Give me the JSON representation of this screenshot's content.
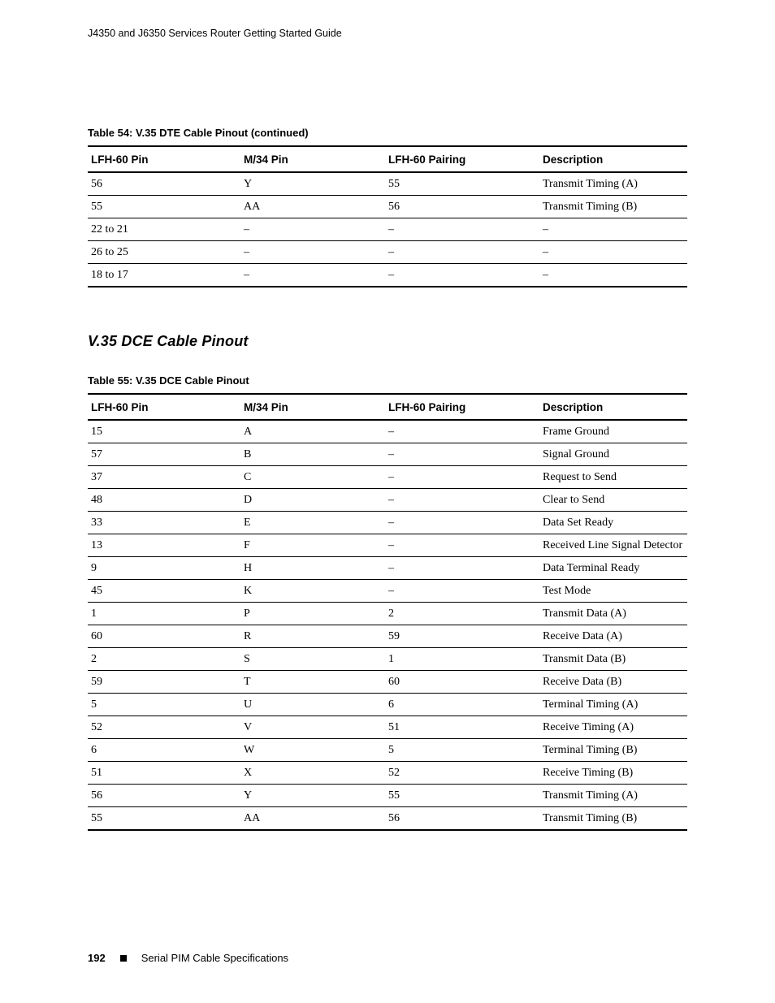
{
  "header": {
    "running_head": "J4350 and J6350 Services Router Getting Started Guide"
  },
  "table54": {
    "caption": "Table 54:  V.35 DTE Cable Pinout (continued)",
    "headers": [
      "LFH-60 Pin",
      "M/34 Pin",
      "LFH-60 Pairing",
      "Description"
    ],
    "rows": [
      [
        "56",
        "Y",
        "55",
        "Transmit Timing (A)"
      ],
      [
        "55",
        "AA",
        "56",
        "Transmit Timing (B)"
      ],
      [
        "22 to 21",
        "–",
        "–",
        "–"
      ],
      [
        "26 to 25",
        "–",
        "–",
        "–"
      ],
      [
        "18 to 17",
        "–",
        "–",
        "–"
      ]
    ]
  },
  "section_heading": "V.35 DCE Cable Pinout",
  "table55": {
    "caption": "Table 55:  V.35 DCE Cable Pinout",
    "headers": [
      "LFH-60 Pin",
      "M/34 Pin",
      "LFH-60 Pairing",
      "Description"
    ],
    "rows": [
      [
        "15",
        "A",
        "–",
        "Frame Ground"
      ],
      [
        "57",
        "B",
        "–",
        "Signal Ground"
      ],
      [
        "37",
        "C",
        "–",
        "Request to Send"
      ],
      [
        "48",
        "D",
        "–",
        "Clear to Send"
      ],
      [
        "33",
        "E",
        "–",
        "Data Set Ready"
      ],
      [
        "13",
        "F",
        "–",
        "Received Line Signal Detector"
      ],
      [
        "9",
        "H",
        "–",
        "Data Terminal Ready"
      ],
      [
        "45",
        "K",
        "–",
        "Test Mode"
      ],
      [
        "1",
        "P",
        "2",
        "Transmit Data (A)"
      ],
      [
        "60",
        "R",
        "59",
        "Receive Data (A)"
      ],
      [
        "2",
        "S",
        "1",
        "Transmit Data (B)"
      ],
      [
        "59",
        "T",
        "60",
        "Receive Data (B)"
      ],
      [
        "5",
        "U",
        "6",
        "Terminal Timing (A)"
      ],
      [
        "52",
        "V",
        "51",
        "Receive Timing (A)"
      ],
      [
        "6",
        "W",
        "5",
        "Terminal Timing (B)"
      ],
      [
        "51",
        "X",
        "52",
        "Receive Timing (B)"
      ],
      [
        "56",
        "Y",
        "55",
        "Transmit Timing (A)"
      ],
      [
        "55",
        "AA",
        "56",
        "Transmit Timing (B)"
      ]
    ]
  },
  "footer": {
    "page_number": "192",
    "section_label": "Serial PIM Cable Specifications"
  }
}
